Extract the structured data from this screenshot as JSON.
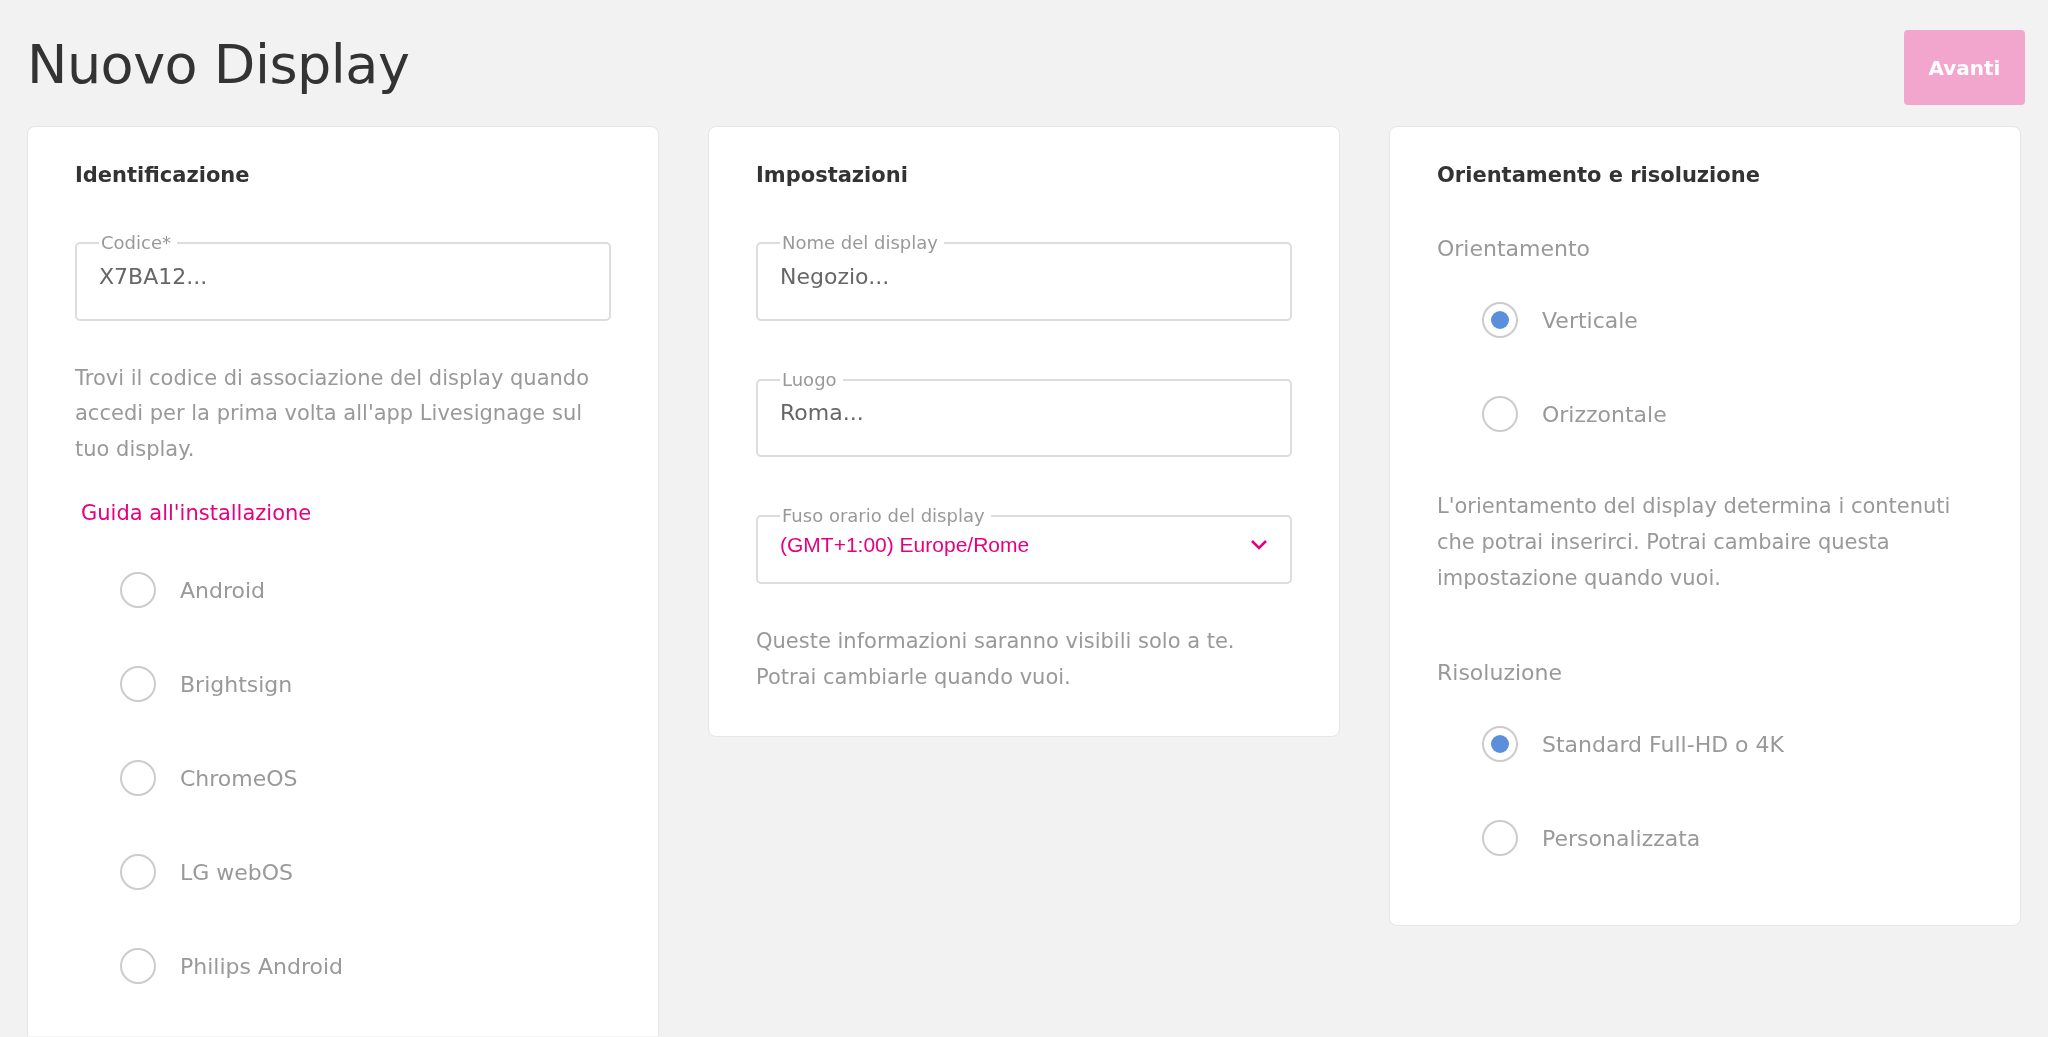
{
  "page": {
    "title": "Nuovo Display",
    "next_button": {
      "label": "Avanti",
      "disabled": true
    }
  },
  "identification": {
    "title": "Identificazione",
    "code_field": {
      "label": "Codice*",
      "value": "X7BA12..."
    },
    "help_text": "Trovi il codice di associazione del display quando accedi per la prima volta all'app Livesignage sul tuo display.",
    "guide_link": "Guida all'installazione",
    "platforms": [
      {
        "label": "Android",
        "selected": false
      },
      {
        "label": "Brightsign",
        "selected": false
      },
      {
        "label": "ChromeOS",
        "selected": false
      },
      {
        "label": "LG webOS",
        "selected": false
      },
      {
        "label": "Philips Android",
        "selected": false
      }
    ]
  },
  "settings": {
    "title": "Impostazioni",
    "fields": [
      {
        "kind": "text",
        "label": "Nome del display",
        "value": "Negozio..."
      },
      {
        "kind": "text",
        "label": "Luogo",
        "value": "Roma..."
      },
      {
        "kind": "select",
        "label": "Fuso orario del display",
        "value": "(GMT+1:00) Europe/Rome"
      }
    ],
    "help_text": "Queste informazioni saranno visibili solo a te. Potrai cambiarle quando vuoi."
  },
  "orientation": {
    "title": "Orientamento e risoluzione",
    "sections": [
      {
        "label": "Orientamento",
        "options": [
          {
            "label": "Verticale",
            "selected": true
          },
          {
            "label": "Orizzontale",
            "selected": false
          }
        ],
        "note": "L'orientamento del display determina i contenuti che potrai inserirci. Potrai cambaire questa impostazione quando vuoi."
      },
      {
        "label": "Risoluzione",
        "options": [
          {
            "label": "Standard Full-HD o 4K",
            "selected": true
          },
          {
            "label": "Personalizzata",
            "selected": false
          }
        ]
      }
    ]
  }
}
